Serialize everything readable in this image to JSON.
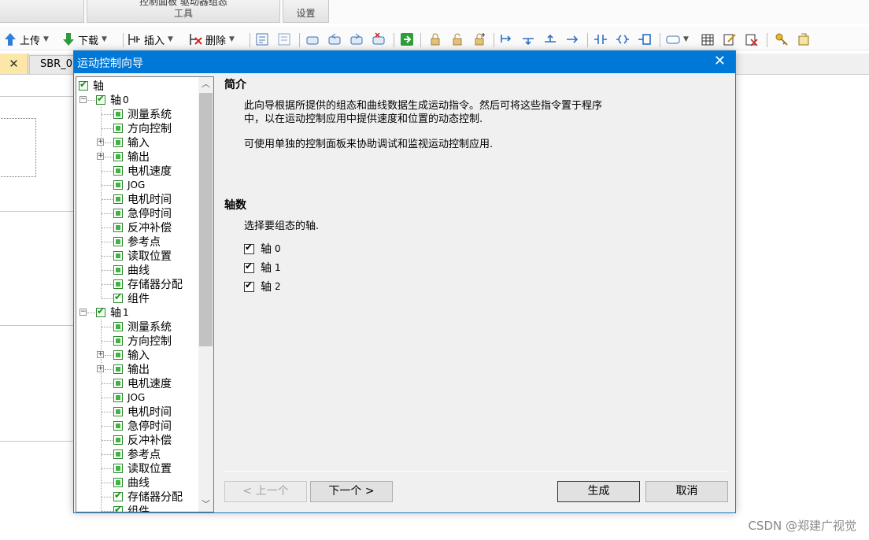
{
  "ribbon": {
    "group_left_label": "",
    "group_tools_cut": "控制面板 驱动器组态",
    "group_tools_label": "工具",
    "group_settings_label": "设置"
  },
  "toolbar": {
    "upload_label": "上传",
    "download_label": "下载",
    "insert_label": "插入",
    "delete_label": "删除"
  },
  "tabs": {
    "close_glyph": "✕",
    "sbr_label": "SBR_0"
  },
  "dialog": {
    "title": "运动控制向导",
    "close_glyph": "✕",
    "tree": {
      "root_label": "轴",
      "axis_prefix": "轴",
      "axes": [
        {
          "num": "0",
          "children": [
            {
              "label": "测量系统",
              "expandable": false,
              "checked": false
            },
            {
              "label": "方向控制",
              "expandable": false,
              "checked": false
            },
            {
              "label": "输入",
              "expandable": true,
              "checked": false
            },
            {
              "label": "输出",
              "expandable": true,
              "checked": false
            },
            {
              "label": "电机速度",
              "expandable": false,
              "checked": false
            },
            {
              "label": "JOG",
              "expandable": false,
              "checked": false
            },
            {
              "label": "电机时间",
              "expandable": false,
              "checked": false
            },
            {
              "label": "急停时间",
              "expandable": false,
              "checked": false
            },
            {
              "label": "反冲补偿",
              "expandable": false,
              "checked": false
            },
            {
              "label": "参考点",
              "expandable": false,
              "checked": false
            },
            {
              "label": "读取位置",
              "expandable": false,
              "checked": false
            },
            {
              "label": "曲线",
              "expandable": false,
              "checked": false
            },
            {
              "label": "存储器分配",
              "expandable": false,
              "checked": false
            },
            {
              "label": "组件",
              "expandable": false,
              "checked": true
            }
          ]
        },
        {
          "num": "1",
          "children": [
            {
              "label": "测量系统",
              "expandable": false,
              "checked": false
            },
            {
              "label": "方向控制",
              "expandable": false,
              "checked": false
            },
            {
              "label": "输入",
              "expandable": true,
              "checked": false
            },
            {
              "label": "输出",
              "expandable": true,
              "checked": false
            },
            {
              "label": "电机速度",
              "expandable": false,
              "checked": false
            },
            {
              "label": "JOG",
              "expandable": false,
              "checked": false
            },
            {
              "label": "电机时间",
              "expandable": false,
              "checked": false
            },
            {
              "label": "急停时间",
              "expandable": false,
              "checked": false
            },
            {
              "label": "反冲补偿",
              "expandable": false,
              "checked": false
            },
            {
              "label": "参考点",
              "expandable": false,
              "checked": false
            },
            {
              "label": "读取位置",
              "expandable": false,
              "checked": false
            },
            {
              "label": "曲线",
              "expandable": false,
              "checked": false
            },
            {
              "label": "存储器分配",
              "expandable": false,
              "checked": true
            },
            {
              "label": "组件",
              "expandable": false,
              "checked": true
            }
          ]
        }
      ]
    },
    "intro_heading": "简介",
    "intro_line1": "此向导根据所提供的组态和曲线数据生成运动指令。然后可将这些指令置于程序",
    "intro_line2": "中，以在运动控制应用中提供速度和位置的动态控制.",
    "intro_line3": "可使用单独的控制面板来协助调试和监视运动控制应用.",
    "axes_heading": "轴数",
    "axes_prompt": "选择要组态的轴.",
    "axis_options": [
      {
        "label": "轴",
        "num": "0",
        "checked": true
      },
      {
        "label": "轴",
        "num": "1",
        "checked": true
      },
      {
        "label": "轴",
        "num": "2",
        "checked": true
      }
    ],
    "buttons": {
      "prev": "< 上一个",
      "next": "下一个 >",
      "generate": "生成",
      "cancel": "取消"
    }
  },
  "watermark": "CSDN @郑建广视觉"
}
